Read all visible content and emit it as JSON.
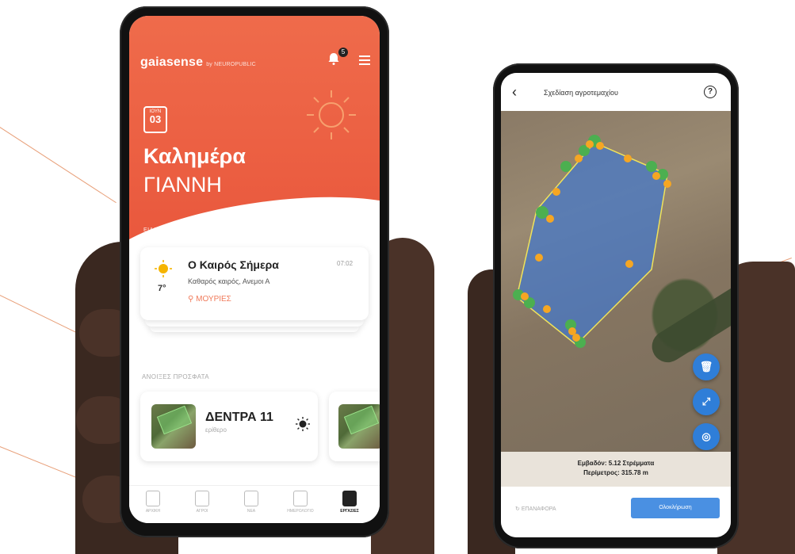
{
  "colors": {
    "accent": "#e9573c",
    "primary_blue": "#4a90e2",
    "field_green": "#4caf50",
    "vertex_orange": "#f5a623"
  },
  "left_phone": {
    "brand": "gaiasense",
    "brand_sub": "by NEUROPUBLIC",
    "notification_count": "5",
    "date": {
      "month": "ΙΟΥΝ",
      "day": "03"
    },
    "greeting": "Καλημέρα",
    "name": "ΓΙΑΝΝΗ",
    "notifications_label": "ΕΙΔΟΠΟΙΗΣΕΙΣ",
    "weather": {
      "title": "Ο Καιρός Σήμερα",
      "time": "07:02",
      "description": "Καθαρός καιρός, Ανεμοι Α",
      "temperature": "7°",
      "location": "ΜΟΥΡΙΕΣ",
      "icon": "sun-icon"
    },
    "recent_label": "ΑΝΟΙΞΕΣ ΠΡΟΣΦΑΤΑ",
    "field_card": {
      "title": "ΔΕΝΤΡΑ 11",
      "subtitle": "ερίθερο"
    },
    "tabs": [
      {
        "label": "ΑΡΧΙΚΗ",
        "icon": "home-icon"
      },
      {
        "label": "ΑΓΡΟΙ",
        "icon": "tag-icon"
      },
      {
        "label": "ΝΕΑ",
        "icon": "news-icon"
      },
      {
        "label": "ΗΜΕΡΟΛΟΓΙΟ",
        "icon": "clipboard-icon"
      },
      {
        "label": "ΕΡΓΑΣΙΕΣ",
        "icon": "tasks-icon",
        "active": true
      }
    ]
  },
  "right_phone": {
    "title": "Σχεδίαση αγροτεμαχίου",
    "area": "Εμβαδόν: 5.12 Στρέμματα",
    "perimeter": "Περίμετρος: 315.78 m",
    "reset_label": "ΕΠΑΝΑΦΟΡΑ",
    "done_label": "Ολοκλήρωση",
    "map_buttons": [
      {
        "icon": "trash-icon"
      },
      {
        "icon": "fit-icon"
      },
      {
        "icon": "locate-icon"
      }
    ]
  }
}
